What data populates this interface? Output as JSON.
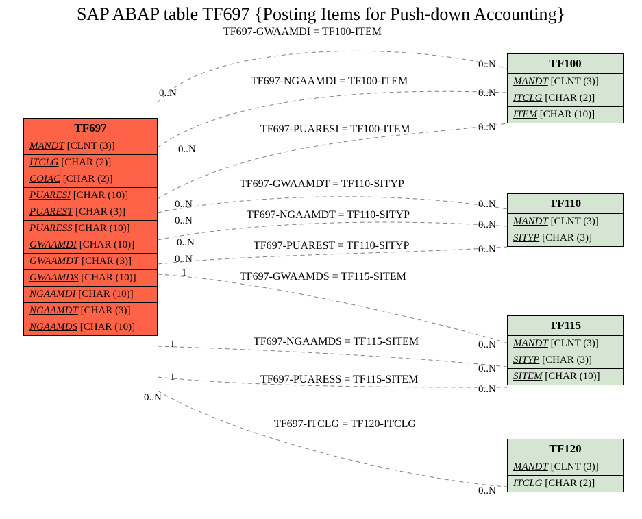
{
  "title": "SAP ABAP table TF697 {Posting Items for Push-down Accounting}",
  "main_entity": {
    "name": "TF697",
    "fields": [
      {
        "name": "MANDT",
        "type": "[CLNT (3)]"
      },
      {
        "name": "ITCLG",
        "type": "[CHAR (2)]"
      },
      {
        "name": "COIAC",
        "type": "[CHAR (2)]"
      },
      {
        "name": "PUARESI",
        "type": "[CHAR (10)]"
      },
      {
        "name": "PUAREST",
        "type": "[CHAR (3)]"
      },
      {
        "name": "PUARESS",
        "type": "[CHAR (10)]"
      },
      {
        "name": "GWAAMDI",
        "type": "[CHAR (10)]"
      },
      {
        "name": "GWAAMDT",
        "type": "[CHAR (3)]"
      },
      {
        "name": "GWAAMDS",
        "type": "[CHAR (10)]"
      },
      {
        "name": "NGAAMDI",
        "type": "[CHAR (10)]"
      },
      {
        "name": "NGAAMDT",
        "type": "[CHAR (3)]"
      },
      {
        "name": "NGAAMDS",
        "type": "[CHAR (10)]"
      }
    ]
  },
  "ref_entities": [
    {
      "name": "TF100",
      "fields": [
        {
          "name": "MANDT",
          "type": "[CLNT (3)]"
        },
        {
          "name": "ITCLG",
          "type": "[CHAR (2)]"
        },
        {
          "name": "ITEM",
          "type": "[CHAR (10)]"
        }
      ]
    },
    {
      "name": "TF110",
      "fields": [
        {
          "name": "MANDT",
          "type": "[CLNT (3)]"
        },
        {
          "name": "SITYP",
          "type": "[CHAR (3)]"
        }
      ]
    },
    {
      "name": "TF115",
      "fields": [
        {
          "name": "MANDT",
          "type": "[CLNT (3)]"
        },
        {
          "name": "SITYP",
          "type": "[CHAR (3)]"
        },
        {
          "name": "SITEM",
          "type": "[CHAR (10)]"
        }
      ]
    },
    {
      "name": "TF120",
      "fields": [
        {
          "name": "MANDT",
          "type": "[CLNT (3)]"
        },
        {
          "name": "ITCLG",
          "type": "[CHAR (2)]"
        }
      ]
    }
  ],
  "relations": [
    {
      "label": "TF697-GWAAMDI = TF100-ITEM"
    },
    {
      "label": "TF697-NGAAMDI = TF100-ITEM"
    },
    {
      "label": "TF697-PUARESI = TF100-ITEM"
    },
    {
      "label": "TF697-GWAAMDT = TF110-SITYP"
    },
    {
      "label": "TF697-NGAAMDT = TF110-SITYP"
    },
    {
      "label": "TF697-PUAREST = TF110-SITYP"
    },
    {
      "label": "TF697-GWAAMDS = TF115-SITEM"
    },
    {
      "label": "TF697-NGAAMDS = TF115-SITEM"
    },
    {
      "label": "TF697-PUARESS = TF115-SITEM"
    },
    {
      "label": "TF697-ITCLG = TF120-ITCLG"
    }
  ],
  "cards": {
    "left": [
      "0..N",
      "0..N",
      "0..N",
      "0..N",
      "0..N",
      "0..N",
      "1",
      "1",
      "1",
      "0..N"
    ],
    "right": [
      "0..N",
      "0..N",
      "0..N",
      "0..N",
      "0..N",
      "0..N",
      "0..N",
      "0..N",
      "0..N",
      "0..N"
    ]
  }
}
